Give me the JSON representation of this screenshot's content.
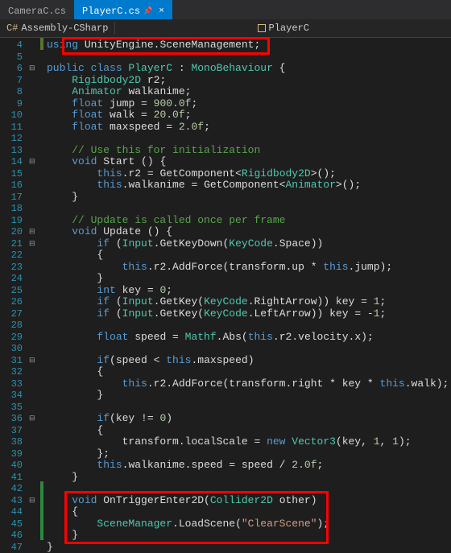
{
  "tabs": {
    "inactive": "CameraC.cs",
    "active": "PlayerC.cs"
  },
  "nav": {
    "project": "Assembly-CSharp",
    "class": "PlayerC"
  },
  "lines": {
    "start": 4,
    "end": 47
  },
  "code": {
    "l4": {
      "kw1": "using",
      "id": " UnityEngine",
      "op": ".",
      "id2": "SceneManagement",
      "pn": ";"
    },
    "l6": {
      "kw1": "public",
      "kw2": " class",
      "type": " PlayerC",
      "op": " : ",
      "type2": "MonoBehaviour",
      "pn": " {"
    },
    "l7": {
      "type": "Rigidbody2D",
      "id": " r2",
      "pn": ";"
    },
    "l8": {
      "type": "Animator",
      "id": " walkanime",
      "pn": ";"
    },
    "l9": {
      "kw": "float",
      "id": " jump = ",
      "num": "900.0f",
      "pn": ";"
    },
    "l10": {
      "kw": "float",
      "id": " walk = ",
      "num": "20.0f",
      "pn": ";"
    },
    "l11": {
      "kw": "float",
      "id": " maxspeed = ",
      "num": "2.0f",
      "pn": ";"
    },
    "l13": {
      "cm": "// Use this for initialization"
    },
    "l14": {
      "kw": "void",
      "id": " Start () {"
    },
    "l15": {
      "kw": "this",
      "op": ".",
      "id": "r2 = GetComponent<",
      "type": "Rigidbody2D",
      "id2": ">();"
    },
    "l16": {
      "kw": "this",
      "op": ".",
      "id": "walkanime = GetComponent<",
      "type": "Animator",
      "id2": ">();"
    },
    "l17": {
      "pn": "}"
    },
    "l19": {
      "cm": "// Update is called once per frame"
    },
    "l20": {
      "kw": "void",
      "id": " Update () {"
    },
    "l21": {
      "kw": "if",
      "id": " (",
      "type": "Input",
      "op": ".",
      "id2": "GetKeyDown(",
      "type2": "KeyCode",
      "op2": ".",
      "id3": "Space))"
    },
    "l22": {
      "pn": "{"
    },
    "l23": {
      "kw": "this",
      "op": ".",
      "id": "r2.AddForce(transform.up * ",
      "kw2": "this",
      "op2": ".",
      "id2": "jump);"
    },
    "l24": {
      "pn": "}"
    },
    "l25": {
      "kw": "int",
      "id": " key = ",
      "num": "0",
      "pn": ";"
    },
    "l26": {
      "kw": "if",
      "id": " (",
      "type": "Input",
      "op": ".",
      "id2": "GetKey(",
      "type2": "KeyCode",
      "op2": ".",
      "id3": "RightArrow)) key = ",
      "num": "1",
      "pn": ";"
    },
    "l27": {
      "kw": "if",
      "id": " (",
      "type": "Input",
      "op": ".",
      "id2": "GetKey(",
      "type2": "KeyCode",
      "op2": ".",
      "id3": "LeftArrow)) key = -",
      "num": "1",
      "pn": ";"
    },
    "l29": {
      "kw": "float",
      "id": " speed = ",
      "type": "Mathf",
      "op": ".",
      "id2": "Abs(",
      "kw2": "this",
      "op2": ".",
      "id3": "r2.velocity.x);"
    },
    "l31": {
      "kw": "if",
      "id": "(speed < ",
      "kw2": "this",
      "op": ".",
      "id2": "maxspeed)"
    },
    "l32": {
      "pn": "{"
    },
    "l33": {
      "kw": "this",
      "op": ".",
      "id": "r2.AddForce(transform.right * key * ",
      "kw2": "this",
      "op2": ".",
      "id2": "walk);"
    },
    "l34": {
      "pn": "}"
    },
    "l36": {
      "kw": "if",
      "id": "(key != ",
      "num": "0",
      "id2": ")"
    },
    "l37": {
      "pn": "{"
    },
    "l38": {
      "id": "transform.localScale = ",
      "kw": "new",
      "type": " Vector3",
      "id2": "(key, ",
      "num": "1",
      "id3": ", ",
      "num2": "1",
      "pn": ");"
    },
    "l39": {
      "pn": "};"
    },
    "l40": {
      "kw": "this",
      "op": ".",
      "id": "walkanime.speed = speed / ",
      "num": "2.0f",
      "pn": ";"
    },
    "l41": {
      "pn": "}"
    },
    "l43": {
      "kw": "void",
      "id": " OnTriggerEnter2D(",
      "type": "Collider2D",
      "id2": " other)"
    },
    "l44": {
      "pn": "{"
    },
    "l45": {
      "type": "SceneManager",
      "op": ".",
      "id": "LoadScene(",
      "str": "\"ClearScene\"",
      "pn": ");"
    },
    "l46": {
      "pn": "}"
    },
    "l47": {
      "pn": "}"
    }
  },
  "fold": {
    "f6": "⊟",
    "f14": "⊟",
    "f20": "⊟",
    "f21": "⊟",
    "f31": "⊟",
    "f36": "⊟",
    "f43": "⊟"
  }
}
